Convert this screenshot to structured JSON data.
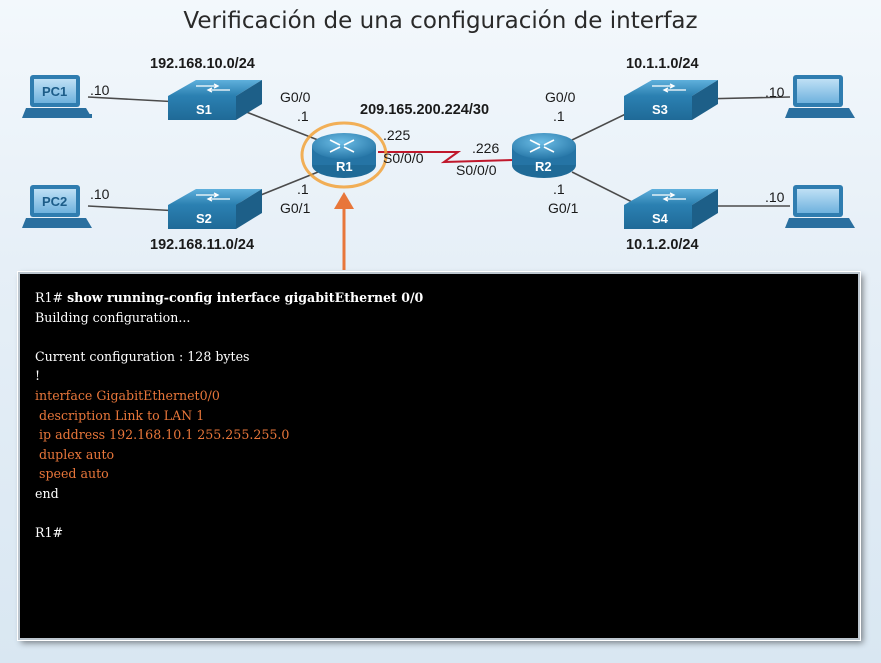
{
  "title": "Verificación de una configuración de interfaz",
  "networks": {
    "lan1": "192.168.10.0/24",
    "lan2": "192.168.11.0/24",
    "wan": "209.165.200.224/30",
    "lan3": "10.1.1.0/24",
    "lan4": "10.1.2.0/24"
  },
  "devices": {
    "pc1": "PC1",
    "pc2": "PC2",
    "s1": "S1",
    "s2": "S2",
    "s3": "S3",
    "s4": "S4",
    "r1": "R1",
    "r2": "R2"
  },
  "addresses": {
    "pc1": ".10",
    "pc2": ".10",
    "pc3": ".10",
    "pc4": ".10",
    "r1_g00_port": "G0/0",
    "r1_g00_addr": ".1",
    "r1_g01_port": "G0/1",
    "r1_g01_addr": ".1",
    "r1_s000_addr": ".225",
    "r1_s000_port": "S0/0/0",
    "r2_s000_addr": ".226",
    "r2_s000_port": "S0/0/0",
    "r2_g00_port": "G0/0",
    "r2_g00_addr": ".1",
    "r2_g01_port": "G0/1",
    "r2_g01_addr": ".1"
  },
  "colors": {
    "device_blue": "#2f86b7",
    "serial_link": "#c0182c",
    "highlight_orange": "#e8763a",
    "terminal_bg": "#000000"
  },
  "terminal": {
    "line1_prompt": "R1#",
    "line1_cmd": "show running-config interface gigabitEthernet 0/0",
    "line2": "Building configuration...",
    "line3": "",
    "line4": "Current configuration : 128 bytes",
    "line5": "!",
    "line6": "interface GigabitEthernet0/0",
    "line7": " description Link to LAN 1",
    "line8": " ip address 192.168.10.1 255.255.255.0",
    "line9": " duplex auto",
    "line10": " speed auto",
    "line11": "end",
    "line12": "",
    "line13": "R1#"
  }
}
